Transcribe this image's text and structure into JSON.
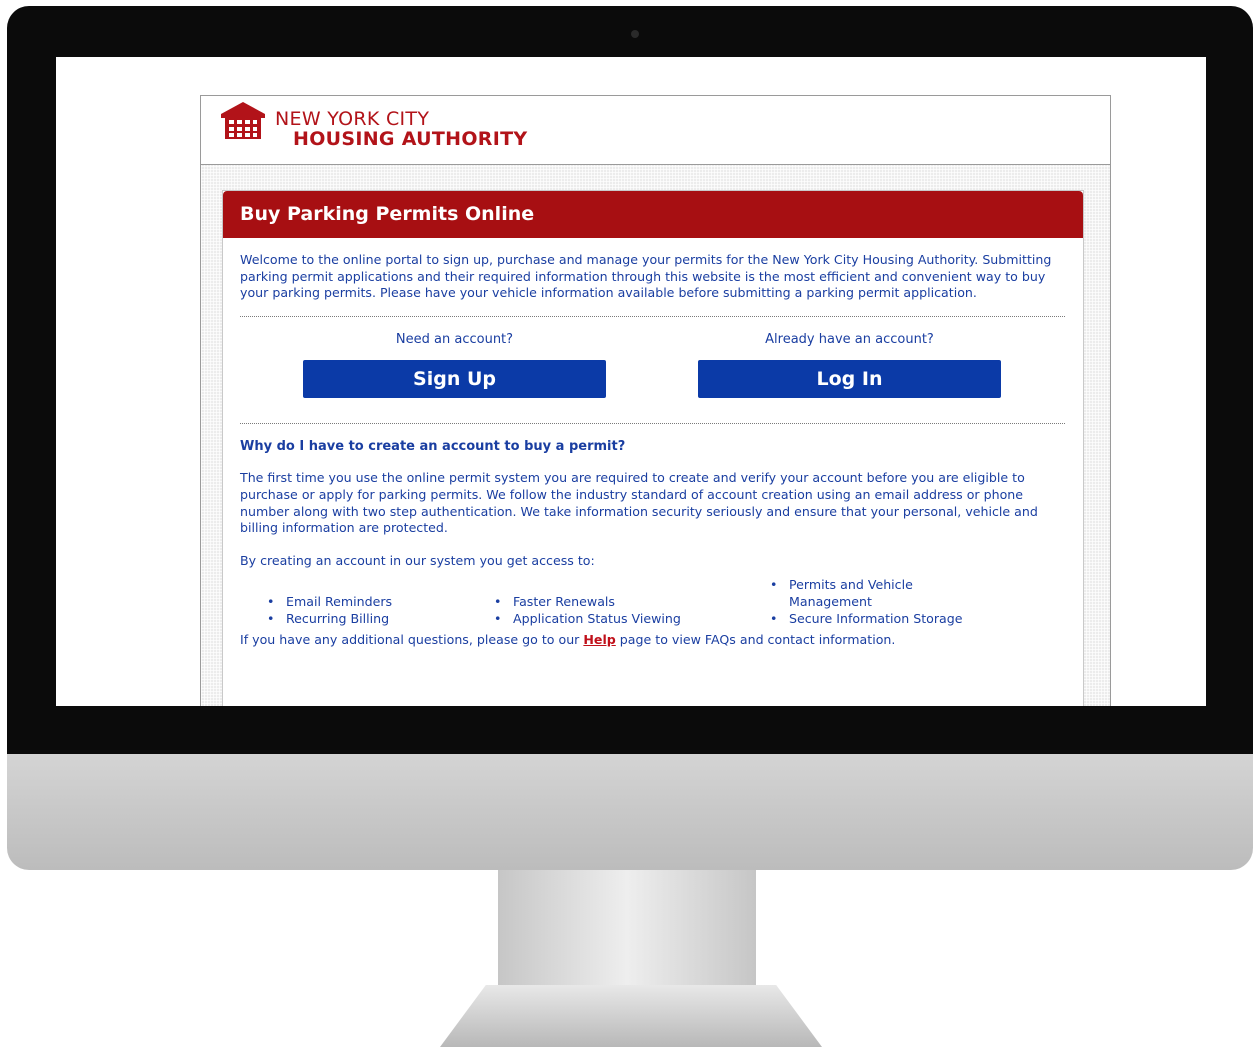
{
  "header": {
    "logo_line1": "NEW YORK CITY",
    "logo_line2": "HOUSING AUTHORITY"
  },
  "panel": {
    "title": "Buy Parking Permits Online",
    "intro": "Welcome to the online portal to sign up, purchase and manage your permits for the New York City Housing Authority. Submitting parking permit applications and their required information through this website is the most efficient and convenient way to buy your parking permits. Please have your vehicle information available before submitting a parking permit application.",
    "signup": {
      "question": "Need an account?",
      "button": "Sign Up"
    },
    "login": {
      "question": "Already have an account?",
      "button": "Log In"
    },
    "why_heading": "Why do I have to create an account to buy a permit?",
    "why_text": "The first time you use the online permit system you are required to create and verify your account before you are eligible to purchase or apply for parking permits. We follow the industry standard of account creation using an email address or phone number along with two step authentication. We take information security seriously and ensure that your personal, vehicle and billing information are protected.",
    "access_intro": "By creating an account in our system you get access to:",
    "benefits": {
      "col1": [
        "Email Reminders",
        "Recurring Billing"
      ],
      "col2": [
        "Faster Renewals",
        "Application Status Viewing"
      ],
      "col3": [
        "Permits and Vehicle Management",
        "Secure Information Storage"
      ]
    },
    "help_before": "If you have any additional questions, please go to our ",
    "help_link": "Help",
    "help_after": " page to view FAQs and contact information."
  },
  "colors": {
    "brand_red": "#a70f12",
    "text_blue": "#1a3ea1",
    "button_blue": "#0b3aa7"
  },
  "icons": [
    "building-logo-icon"
  ]
}
